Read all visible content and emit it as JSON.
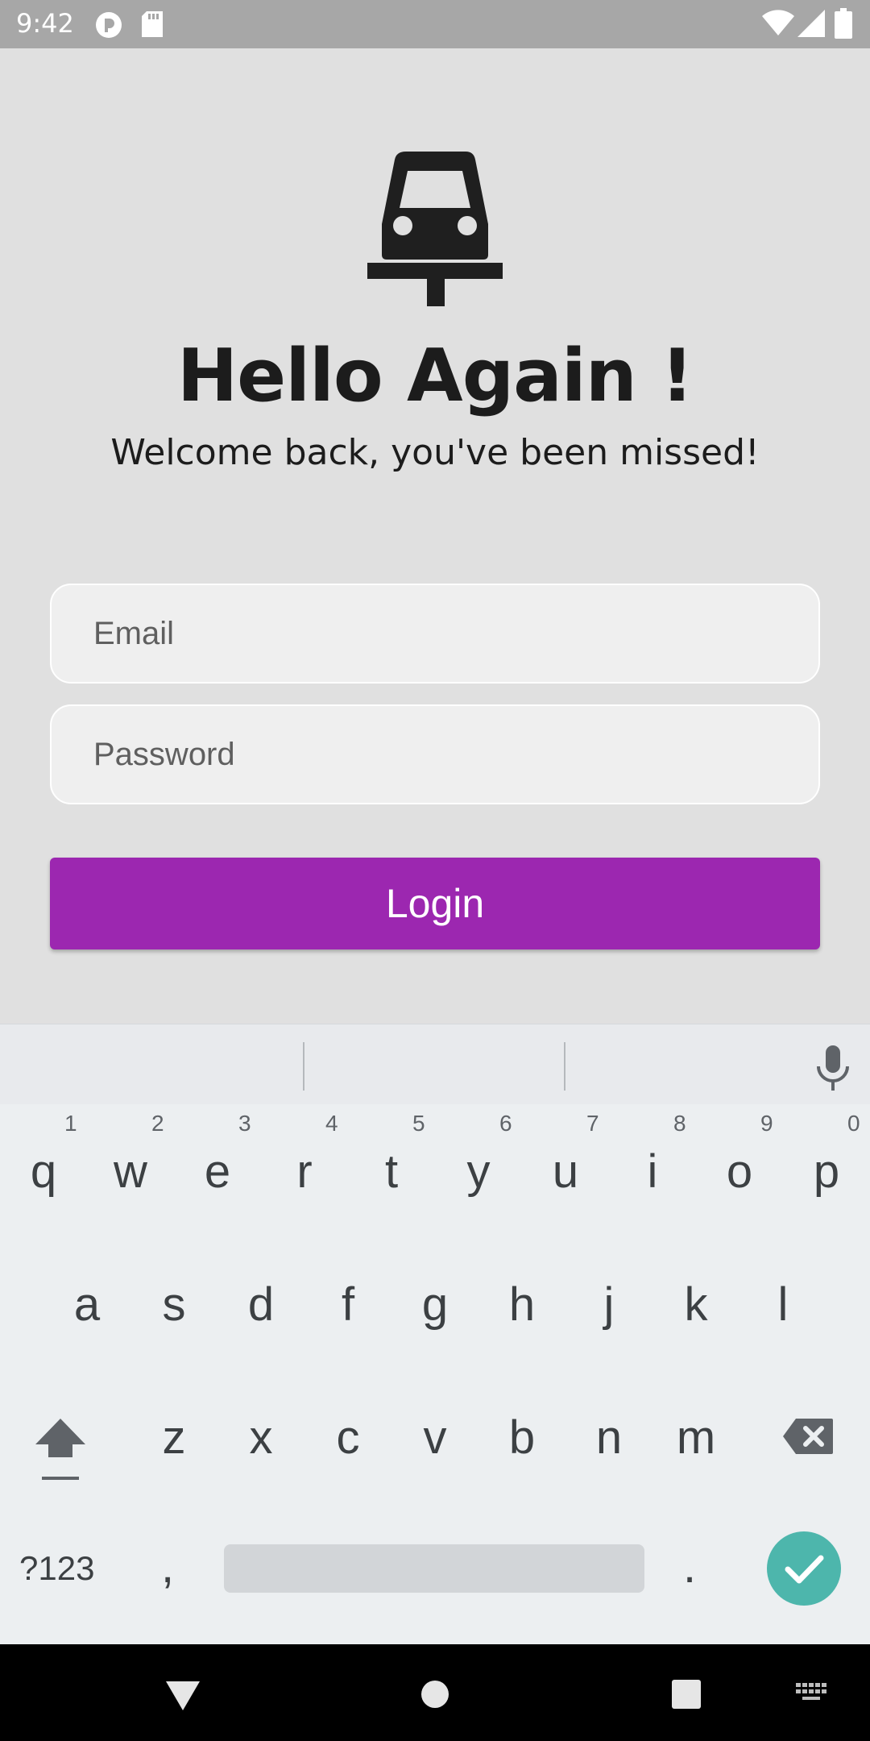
{
  "status_bar": {
    "time": "9:42",
    "icons": [
      "pocket-icon",
      "sd-card-icon",
      "wifi-icon",
      "signal-icon",
      "battery-icon"
    ]
  },
  "header": {
    "logo_icon": "car-icon",
    "title": "Hello Again !",
    "subtitle": "Welcome back, you've been missed!"
  },
  "form": {
    "email_placeholder": "Email",
    "email_value": "",
    "password_placeholder": "Password",
    "password_value": "",
    "login_label": "Login",
    "accent_color": "#9c27b0"
  },
  "keyboard": {
    "row1": [
      {
        "key": "q",
        "hint": "1"
      },
      {
        "key": "w",
        "hint": "2"
      },
      {
        "key": "e",
        "hint": "3"
      },
      {
        "key": "r",
        "hint": "4"
      },
      {
        "key": "t",
        "hint": "5"
      },
      {
        "key": "y",
        "hint": "6"
      },
      {
        "key": "u",
        "hint": "7"
      },
      {
        "key": "i",
        "hint": "8"
      },
      {
        "key": "o",
        "hint": "9"
      },
      {
        "key": "p",
        "hint": "0"
      }
    ],
    "row2": [
      "a",
      "s",
      "d",
      "f",
      "g",
      "h",
      "j",
      "k",
      "l"
    ],
    "row3": [
      "z",
      "x",
      "c",
      "v",
      "b",
      "n",
      "m"
    ],
    "symbols_label": "?123",
    "comma": ",",
    "period": ".",
    "enter_color": "#4db6ac"
  },
  "nav_bar": {
    "icons": [
      "back-icon",
      "home-icon",
      "recents-icon",
      "keyboard-switch-icon"
    ]
  }
}
